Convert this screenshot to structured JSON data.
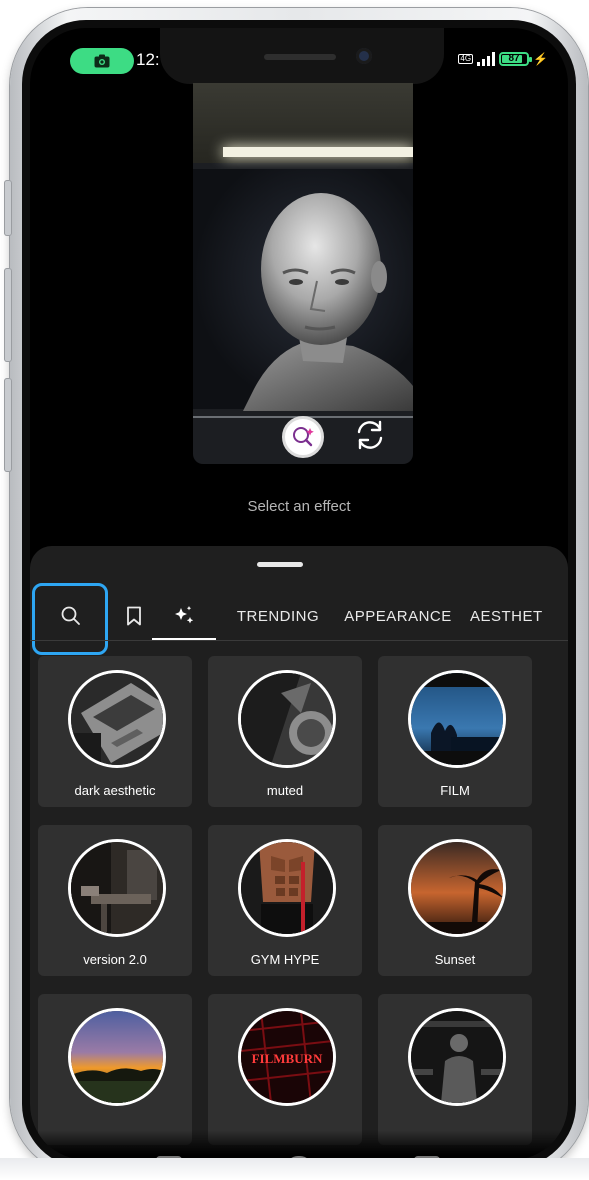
{
  "status_bar": {
    "time": "12:",
    "battery_level": "87",
    "network_badge": "4G",
    "accent_color": "#3ddc84"
  },
  "preview": {
    "hint": "Select an effect",
    "effect_icon": "effect-search-icon",
    "flip_icon": "camera-flip-icon"
  },
  "tabs": [
    {
      "icon": "search-icon",
      "selected": false,
      "highlighted": true
    },
    {
      "icon": "bookmark-icon",
      "selected": false
    },
    {
      "icon": "sparkles-icon",
      "selected": true
    },
    {
      "label": "TRENDING"
    },
    {
      "label": "APPEARANCE"
    },
    {
      "label": "AESTHET"
    }
  ],
  "effects": [
    {
      "label": "dark aesthetic"
    },
    {
      "label": "muted"
    },
    {
      "label": "FILM"
    },
    {
      "label": "version 2.0"
    },
    {
      "label": "GYM HYPE"
    },
    {
      "label": "Sunset"
    },
    {
      "label": ""
    },
    {
      "label": "",
      "thumb_text": "FILMBURN"
    },
    {
      "label": ""
    }
  ],
  "colors": {
    "highlight": "#2ea6f3",
    "sheet": "#1f1f1f",
    "card": "#303030"
  }
}
